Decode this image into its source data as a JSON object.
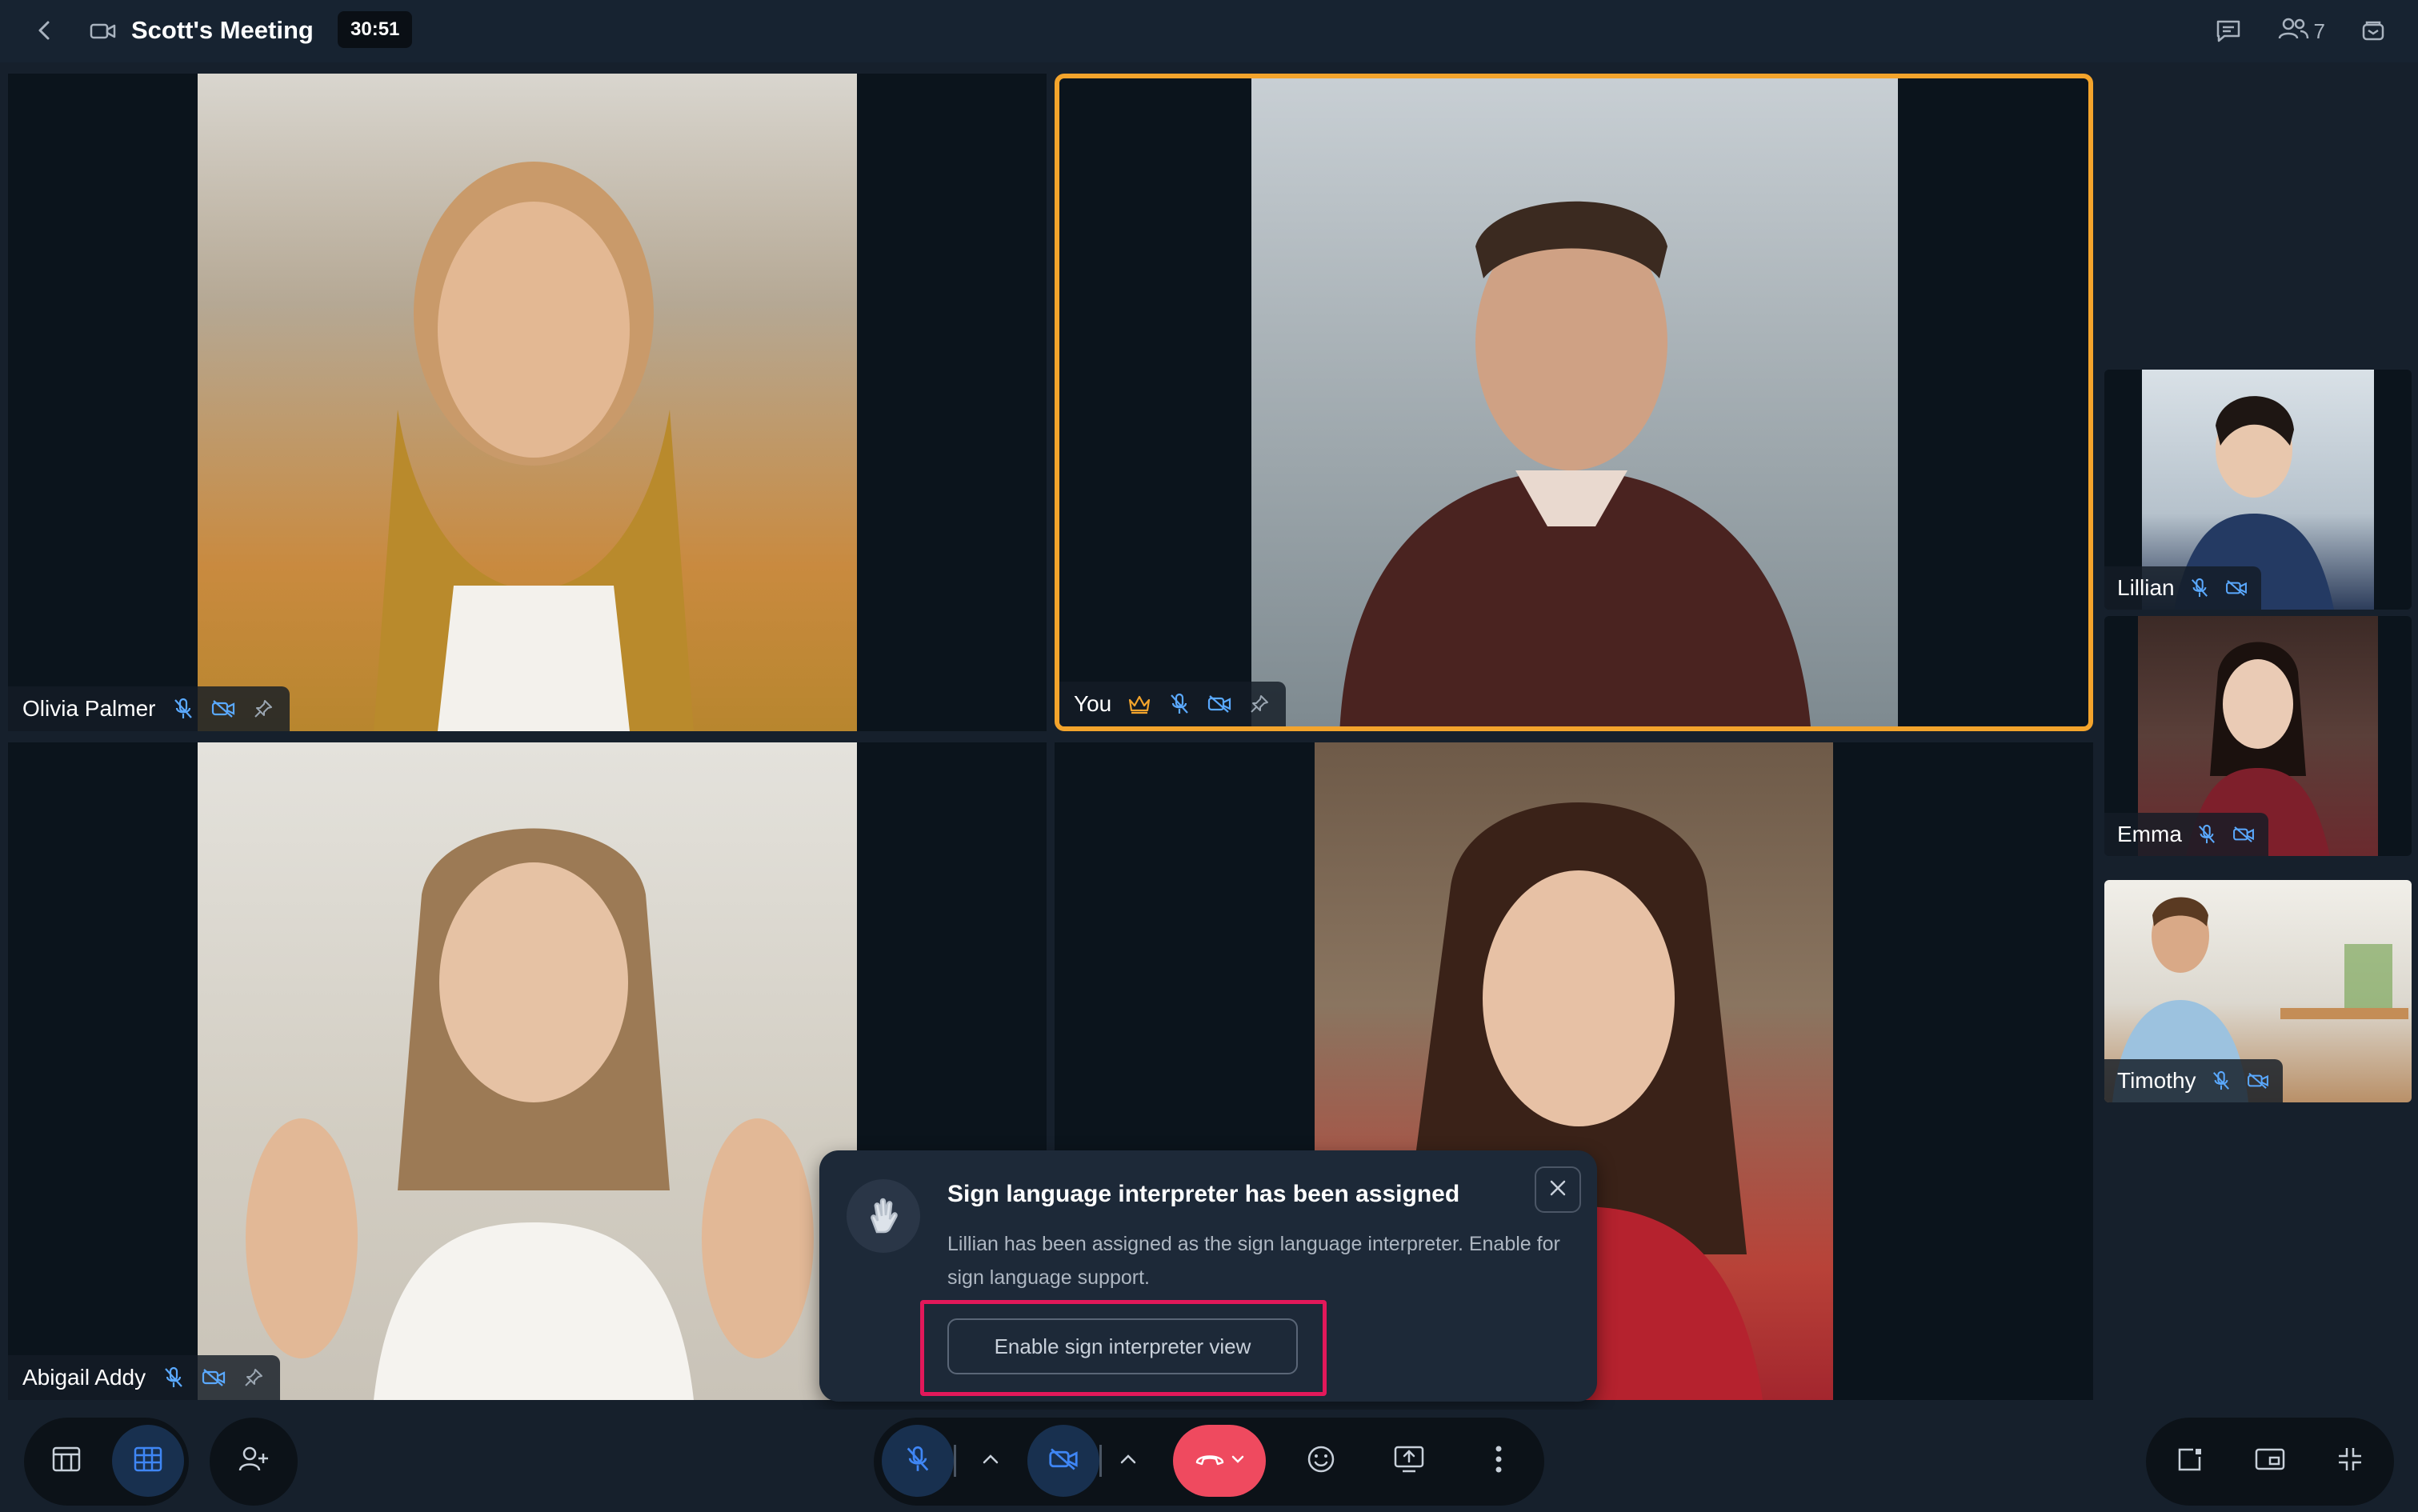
{
  "topbar": {
    "title": "Scott's Meeting",
    "timer": "30:51",
    "participants_count": "7",
    "icons": [
      "back-chevron-icon",
      "video-camera-icon",
      "chat-icon",
      "participants-icon",
      "layers-icon"
    ]
  },
  "tiles": [
    {
      "name": "Olivia Palmer"
    },
    {
      "name": "You",
      "host_icon": "crown-icon"
    },
    {
      "name": "Abigail Addy"
    },
    {
      "name": ""
    }
  ],
  "thumbnails": [
    {
      "name": "Lillian"
    },
    {
      "name": "Emma"
    },
    {
      "name": "Timothy"
    }
  ],
  "toast": {
    "title": "Sign language interpreter has been assigned",
    "body": "Lillian has been assigned as the sign language interpreter. Enable for sign language support.",
    "button_label": "Enable sign interpreter view"
  },
  "colors": {
    "accent_active": "#f3a42c",
    "end_call": "#ef4a5f",
    "highlight": "#e2185a",
    "primary_blue": "#2d6fd6"
  }
}
